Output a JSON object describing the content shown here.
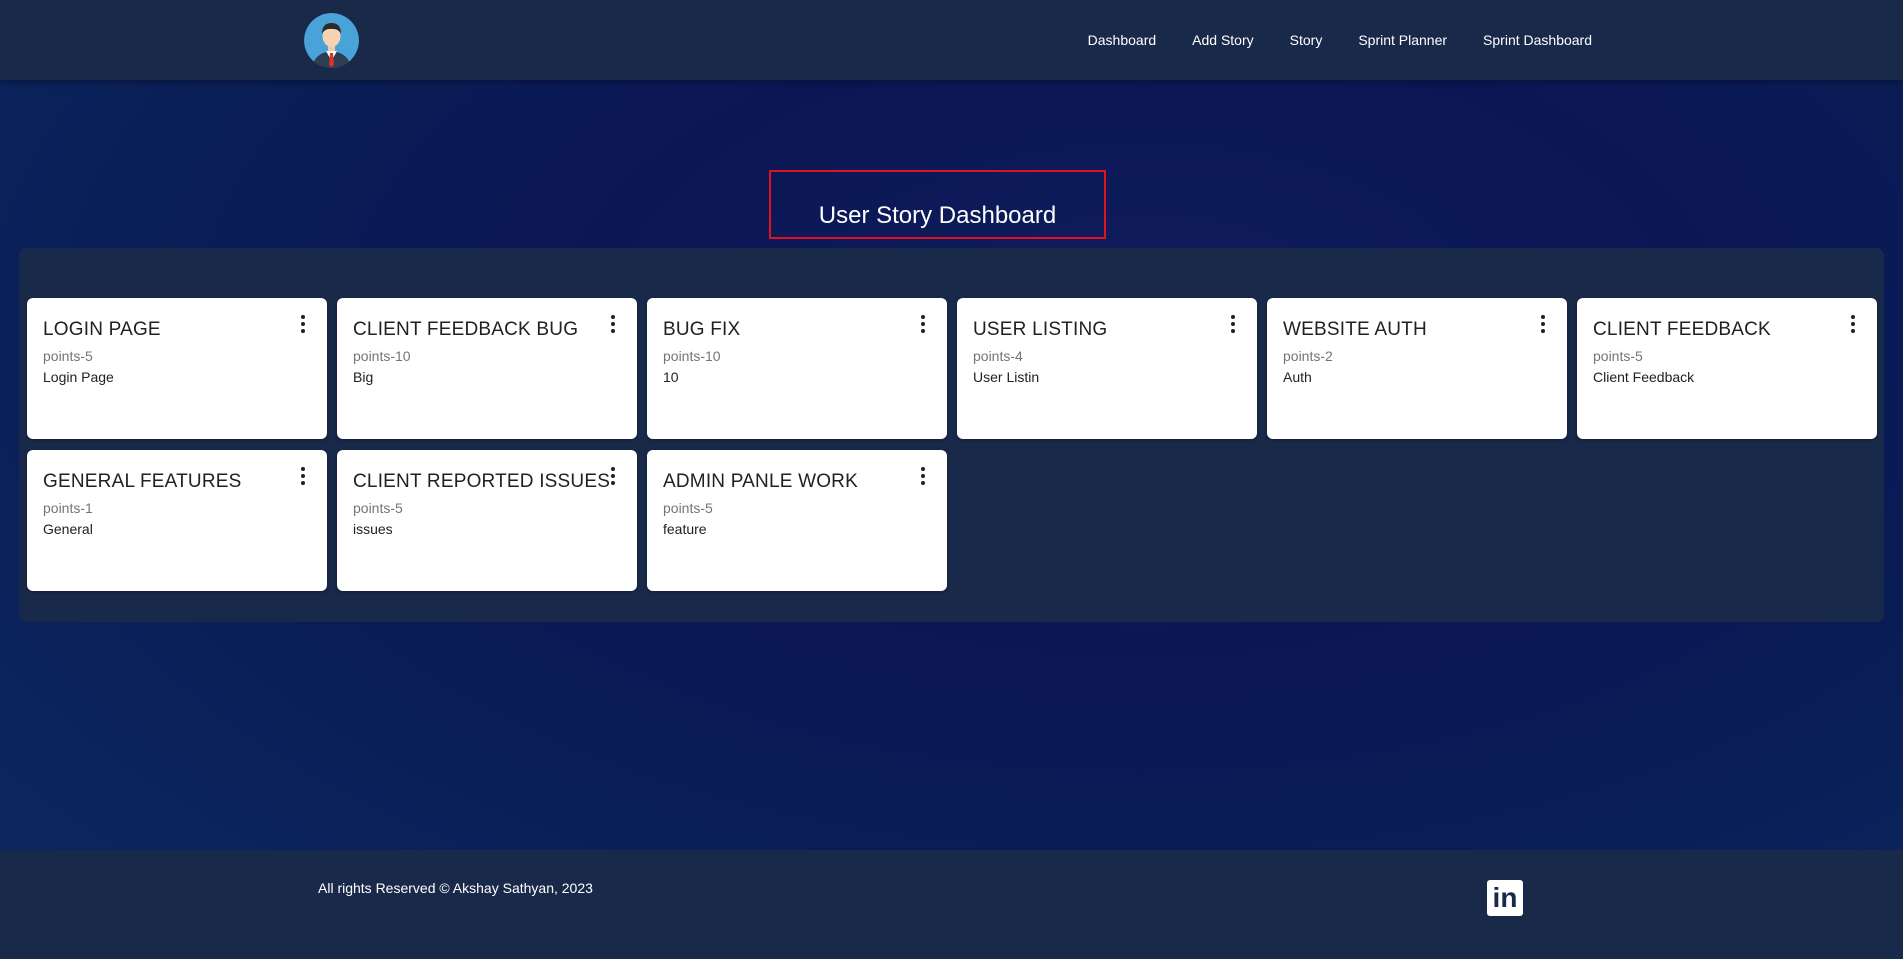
{
  "nav": {
    "avatar_icon": "user-avatar-icon",
    "links": [
      {
        "label": "Dashboard"
      },
      {
        "label": "Add Story"
      },
      {
        "label": "Story"
      },
      {
        "label": "Sprint Planner"
      },
      {
        "label": "Sprint Dashboard"
      }
    ]
  },
  "main": {
    "title": "User Story Dashboard",
    "title_border_color": "#e0121b"
  },
  "stories": [
    {
      "title": "LOGIN PAGE",
      "points": "points-5",
      "description": "Login Page"
    },
    {
      "title": "CLIENT FEEDBACK BUG",
      "points": "points-10",
      "description": "Big"
    },
    {
      "title": "BUG FIX",
      "points": "points-10",
      "description": "10"
    },
    {
      "title": "USER LISTING",
      "points": "points-4",
      "description": "User Listin"
    },
    {
      "title": "WEBSITE AUTH",
      "points": "points-2",
      "description": "Auth"
    },
    {
      "title": "CLIENT FEEDBACK",
      "points": "points-5",
      "description": "Client Feedback"
    },
    {
      "title": "GENERAL FEATURES",
      "points": "points-1",
      "description": "General"
    },
    {
      "title": "CLIENT REPORTED ISSUES",
      "points": "points-5",
      "description": "issues"
    },
    {
      "title": "ADMIN PANLE WORK",
      "points": "points-5",
      "description": "feature"
    }
  ],
  "footer": {
    "copyright": "All rights Reserved © Akshay Sathyan, 2023",
    "linkedin_icon": "linkedin-icon",
    "linkedin_glyph": "in"
  },
  "colors": {
    "navbar_bg": "#19294a",
    "card_bg": "#ffffff",
    "accent_red": "#e0121b"
  }
}
